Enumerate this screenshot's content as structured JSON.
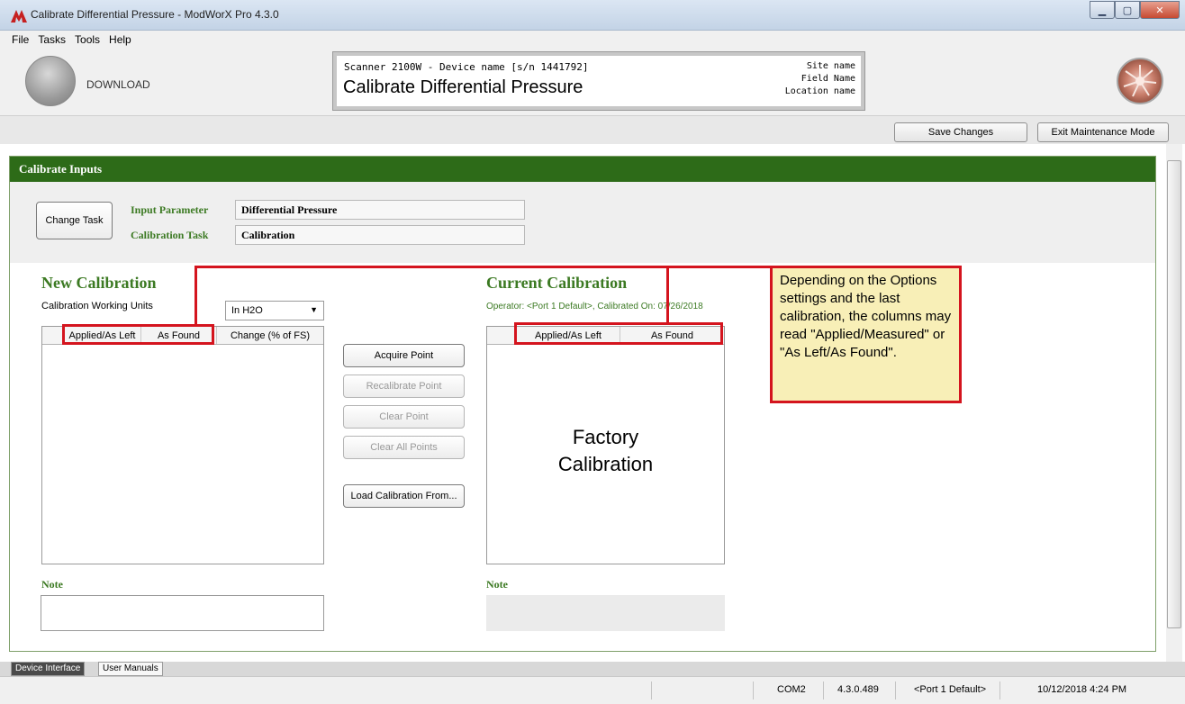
{
  "window": {
    "title": "Calibrate Differential Pressure - ModWorX Pro 4.3.0"
  },
  "menu": {
    "items": [
      "File",
      "Tasks",
      "Tools",
      "Help"
    ]
  },
  "header": {
    "download_label": "DOWNLOAD",
    "device_line": "Scanner 2100W - Device name [s/n 1441792]",
    "page_title": "Calibrate Differential Pressure",
    "site": "Site name",
    "field": "Field Name",
    "location": "Location name"
  },
  "toolbar": {
    "save_label": "Save Changes",
    "exit_label": "Exit Maintenance Mode"
  },
  "panel": {
    "title": "Calibrate Inputs",
    "change_task_label": "Change Task",
    "input_parameter_label": "Input Parameter",
    "input_parameter_value": "Differential Pressure",
    "calibration_task_label": "Calibration Task",
    "calibration_task_value": "Calibration"
  },
  "new_calibration": {
    "title": "New Calibration",
    "units_label": "Calibration Working Units",
    "units_value": "In H2O",
    "columns": [
      "Applied/As Left",
      "As Found",
      "Change (% of FS)"
    ],
    "note_label": "Note"
  },
  "actions": {
    "acquire": "Acquire Point",
    "recalibrate": "Recalibrate Point",
    "clear": "Clear Point",
    "clear_all": "Clear All Points",
    "load": "Load Calibration From..."
  },
  "current_calibration": {
    "title": "Current Calibration",
    "operator_line": "Operator: <Port 1 Default>, Calibrated On: 07/26/2018",
    "columns": [
      "Applied/As Left",
      "As Found"
    ],
    "placeholder_line1": "Factory",
    "placeholder_line2": "Calibration",
    "note_label": "Note"
  },
  "callout": {
    "text": "Depending on the Options settings and the last calibration, the columns may read \"Applied/Measured\" or \"As Left/As Found\"."
  },
  "bottom_tabs": [
    "Device Interface",
    "User Manuals"
  ],
  "status": {
    "port": "COM2",
    "version": "4.3.0.489",
    "user": "<Port 1 Default>",
    "datetime": "10/12/2018 4:24 PM"
  },
  "colors": {
    "panel_header": "#2d6b18",
    "label_green": "#3c7a23",
    "highlight_red": "#d4141e",
    "callout_bg": "#f8efb7"
  }
}
